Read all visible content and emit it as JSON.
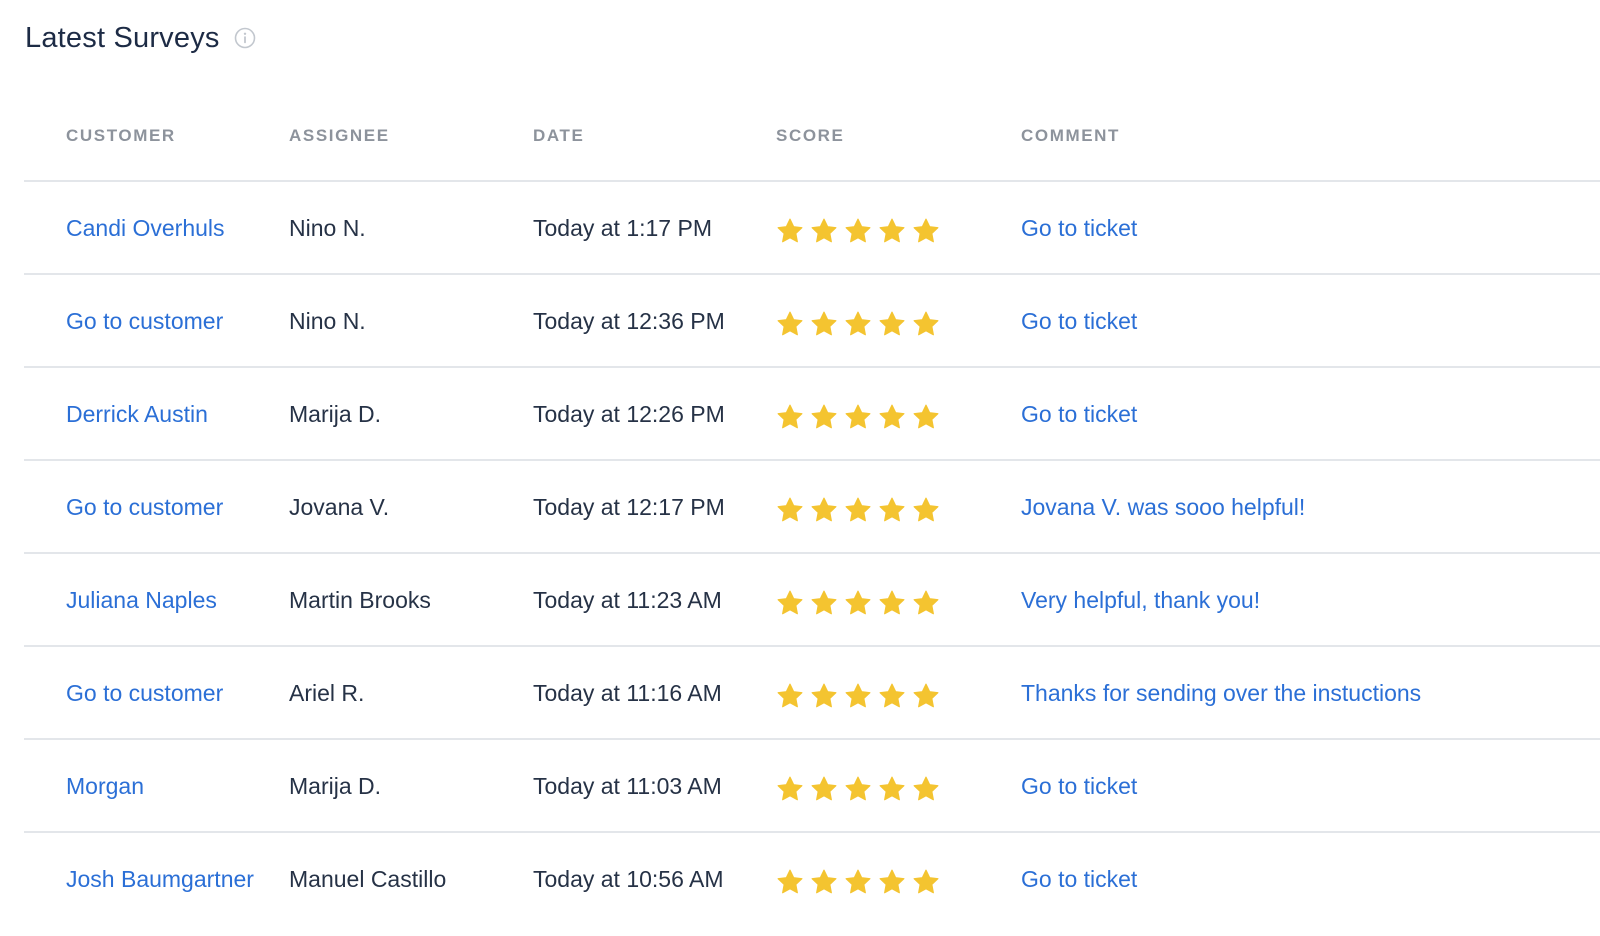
{
  "title": "Latest Surveys",
  "colors": {
    "link": "#2b6fd6",
    "star": "#f4c430",
    "header_text": "#8d939c",
    "divider": "#e3e6ea"
  },
  "table": {
    "columns": [
      "CUSTOMER",
      "ASSIGNEE",
      "DATE",
      "SCORE",
      "COMMENT"
    ],
    "rows": [
      {
        "customer": "Candi Overhuls",
        "assignee": "Nino N.",
        "date": "Today at 1:17 PM",
        "score": 5,
        "comment": "Go to ticket"
      },
      {
        "customer": "Go to customer",
        "assignee": "Nino N.",
        "date": "Today at 12:36 PM",
        "score": 5,
        "comment": "Go to ticket"
      },
      {
        "customer": "Derrick Austin",
        "assignee": "Marija D.",
        "date": "Today at 12:26 PM",
        "score": 5,
        "comment": "Go to ticket"
      },
      {
        "customer": "Go to customer",
        "assignee": "Jovana V.",
        "date": "Today at 12:17 PM",
        "score": 5,
        "comment": "Jovana V. was sooo helpful!"
      },
      {
        "customer": "Juliana Naples",
        "assignee": "Martin Brooks",
        "date": "Today at 11:23 AM",
        "score": 5,
        "comment": "Very helpful, thank you!"
      },
      {
        "customer": "Go to customer",
        "assignee": "Ariel R.",
        "date": "Today at 11:16 AM",
        "score": 5,
        "comment": "Thanks for sending over the instuctions"
      },
      {
        "customer": "Morgan",
        "assignee": "Marija D.",
        "date": "Today at 11:03 AM",
        "score": 5,
        "comment": "Go to ticket"
      },
      {
        "customer": "Josh Baumgartner",
        "assignee": "Manuel Castillo",
        "date": "Today at 10:56 AM",
        "score": 5,
        "comment": "Go to ticket"
      }
    ]
  }
}
